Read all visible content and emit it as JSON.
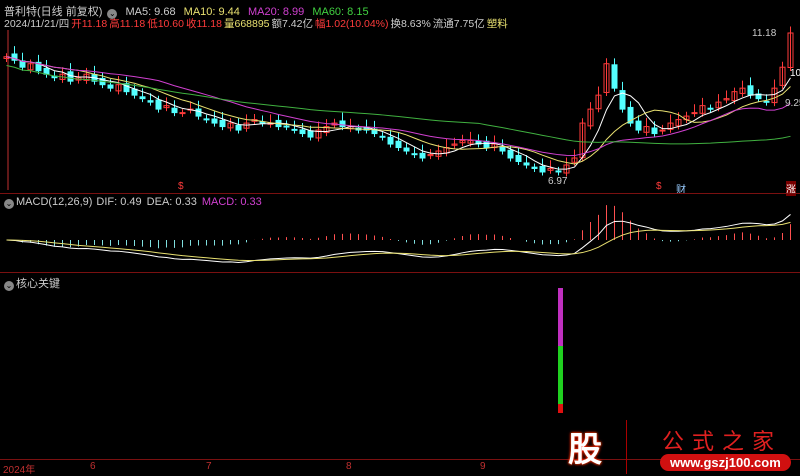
{
  "header": {
    "title": "普利特(日线 前复权)",
    "ma5": "MA5: 9.68",
    "ma10": "MA10: 9.44",
    "ma20": "MA20: 8.99",
    "ma60": "MA60: 8.15"
  },
  "info": {
    "date": "2024/11/21/四",
    "open": "开11.18",
    "high": "高11.18",
    "low": "低10.60",
    "close": "收11.18",
    "volume": "量668895",
    "amount": "额7.42亿",
    "change": "幅1.02(10.04%)",
    "turnover": "换8.63%",
    "float": "流通7.75亿",
    "sector": "塑料"
  },
  "price_labels": {
    "high": "11.18",
    "low": "6.97",
    "mid1": "10",
    "mid2": "9.25"
  },
  "markers": {
    "m1": "$",
    "m2": "$",
    "m3": "财",
    "m4": "涨"
  },
  "macd": {
    "title": "MACD(12,26,9)",
    "dif": "DIF: 0.49",
    "dea": "DEA: 0.33",
    "macd": "MACD: 0.33"
  },
  "indicator": {
    "title": "核心关键"
  },
  "axis": {
    "labels": [
      "2024年",
      "6",
      "7",
      "8",
      "9"
    ]
  },
  "logo": {
    "glyph": "股",
    "name": "公式之家",
    "url": "www.gszj100.com"
  },
  "colors": {
    "up": "#ff3b3b",
    "down": "#54ffff",
    "ma5": "#ffffff",
    "ma10": "#e8e070",
    "ma20": "#d040d0",
    "ma60": "#40b040"
  },
  "closes": [
    10.5,
    10.4,
    10.2,
    10.3,
    10.1,
    10.0,
    9.9,
    10.0,
    9.8,
    9.9,
    10.0,
    9.8,
    9.7,
    9.6,
    9.7,
    9.5,
    9.4,
    9.3,
    9.2,
    9.0,
    9.1,
    8.9,
    8.9,
    9.0,
    8.8,
    8.7,
    8.6,
    8.5,
    8.6,
    8.4,
    8.6,
    8.7,
    8.6,
    8.6,
    8.5,
    8.5,
    8.4,
    8.3,
    8.2,
    8.4,
    8.5,
    8.6,
    8.5,
    8.5,
    8.4,
    8.4,
    8.3,
    8.2,
    8.0,
    7.9,
    7.8,
    7.7,
    7.6,
    7.7,
    7.8,
    7.9,
    8.0,
    8.1,
    8.1,
    8.0,
    7.9,
    8.0,
    7.8,
    7.6,
    7.5,
    7.4,
    7.3,
    7.2,
    7.3,
    7.2,
    7.4,
    7.6,
    8.6,
    9.0,
    9.4,
    10.3,
    9.6,
    9.0,
    8.6,
    8.4,
    8.5,
    8.3,
    8.4,
    8.6,
    8.7,
    8.8,
    8.9,
    9.1,
    9.0,
    9.2,
    9.3,
    9.5,
    9.6,
    9.4,
    9.3,
    9.2,
    9.6,
    10.2,
    11.18
  ]
}
